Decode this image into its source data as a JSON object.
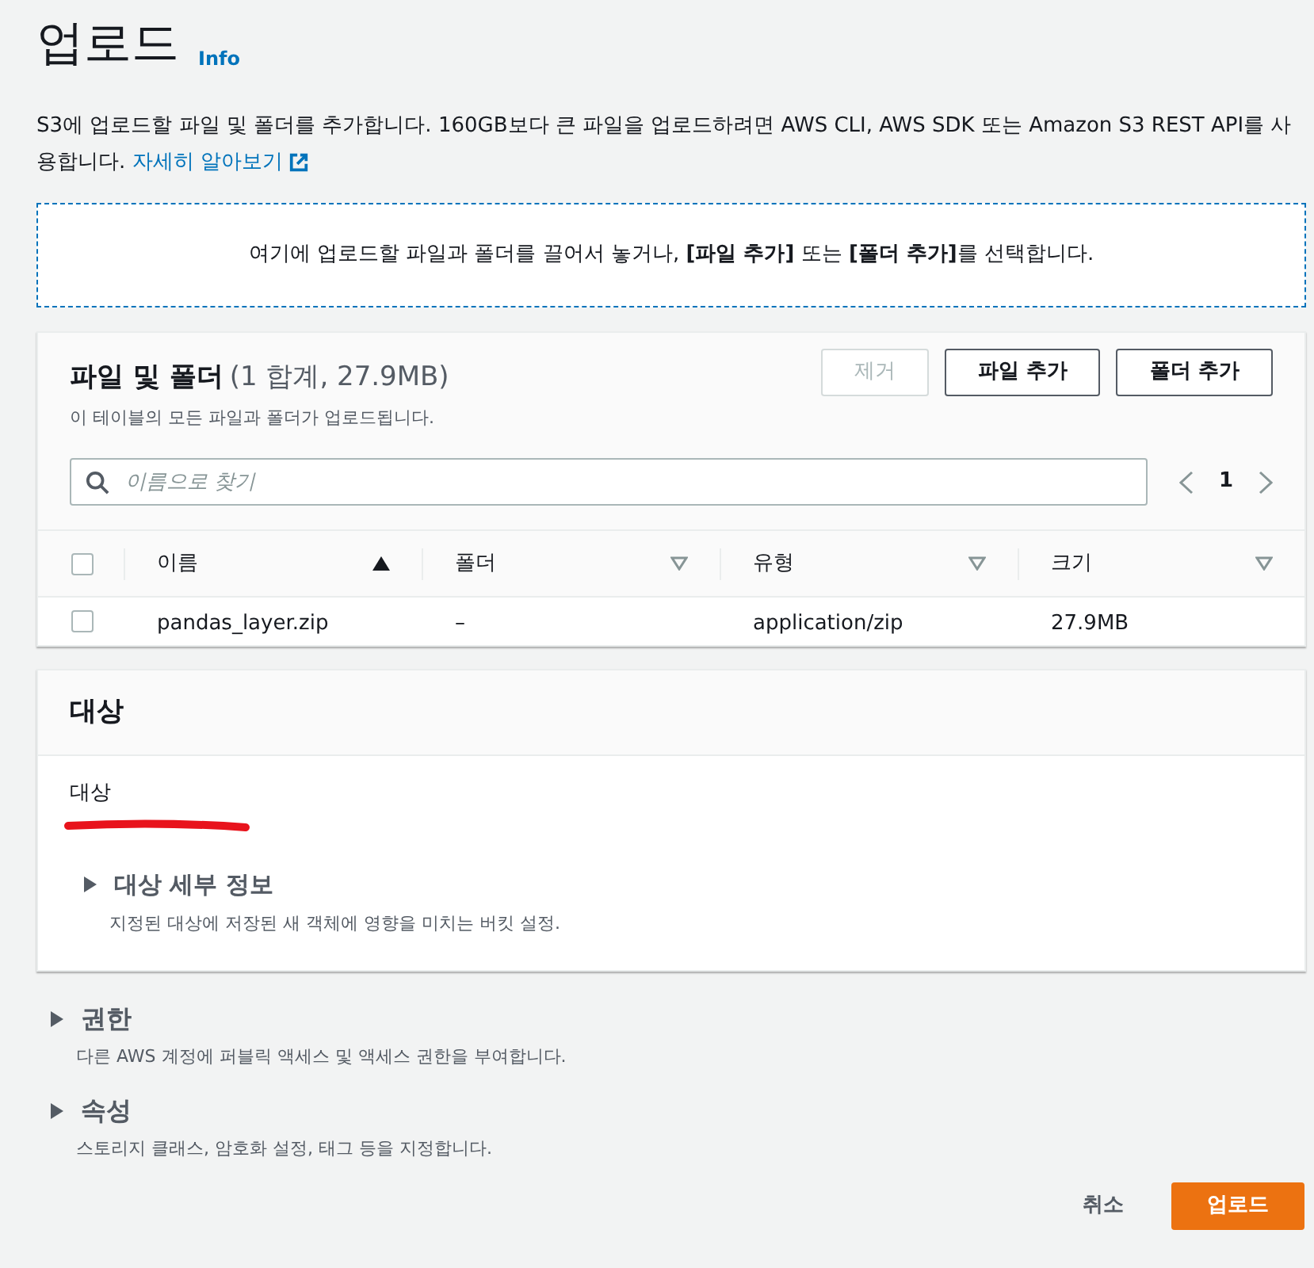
{
  "header": {
    "title": "업로드",
    "info_link": "Info"
  },
  "description": {
    "text": "S3에 업로드할 파일 및 폴더를 추가합니다. 160GB보다 큰 파일을 업로드하려면 AWS CLI, AWS SDK 또는 Amazon S3 REST API를 사용합니다.",
    "link": "자세히 알아보기"
  },
  "drop_zone": {
    "text": "여기에 업로드할 파일과 폴더를 끌어서 놓거나, **[파일 추가]** 또는 **[폴더 추가]**를 선택합니다."
  },
  "files_panel": {
    "title": "파일 및 폴더",
    "count": "(1 합계, 27.9MB)",
    "subtitle": "이 테이블의 모든 파일과 폴더가 업로드됩니다.",
    "buttons": [
      {
        "label": "제거",
        "disabled": true
      },
      {
        "label": "파일 추가",
        "disabled": false
      },
      {
        "label": "폴더 추가",
        "disabled": false
      }
    ],
    "search": {
      "placeholder": "이름으로 찾기"
    },
    "pagination": {
      "page": "1"
    },
    "table": {
      "select_all_checked": false,
      "columns": [
        {
          "label": "이름",
          "sorted": true
        },
        {
          "label": "폴더",
          "sorted": false
        },
        {
          "label": "유형",
          "sorted": false
        },
        {
          "label": "크기",
          "sorted": false
        }
      ],
      "rows": [
        {
          "checked": false,
          "cells": [
            "pandas_layer.zip",
            "–",
            "application/zip",
            "27.9MB"
          ]
        }
      ]
    }
  },
  "destination_panel": {
    "title": "대상",
    "field_label": "대상",
    "value_redacted": true,
    "details": {
      "title": "대상 세부 정보",
      "description": "지정된 대상에 저장된 새 객체에 영향을 미치는 버킷 설정.",
      "expanded": false
    }
  },
  "sections": [
    {
      "title": "권한",
      "description": "다른 AWS 계정에 퍼블릭 액세스 및 액세스 권한을 부여합니다.",
      "expanded": false
    },
    {
      "title": "속성",
      "description": "스토리지 클래스, 암호화 설정, 태그 등을 지정합니다.",
      "expanded": false
    }
  ],
  "footer": {
    "cancel": "취소",
    "submit": "업로드"
  }
}
